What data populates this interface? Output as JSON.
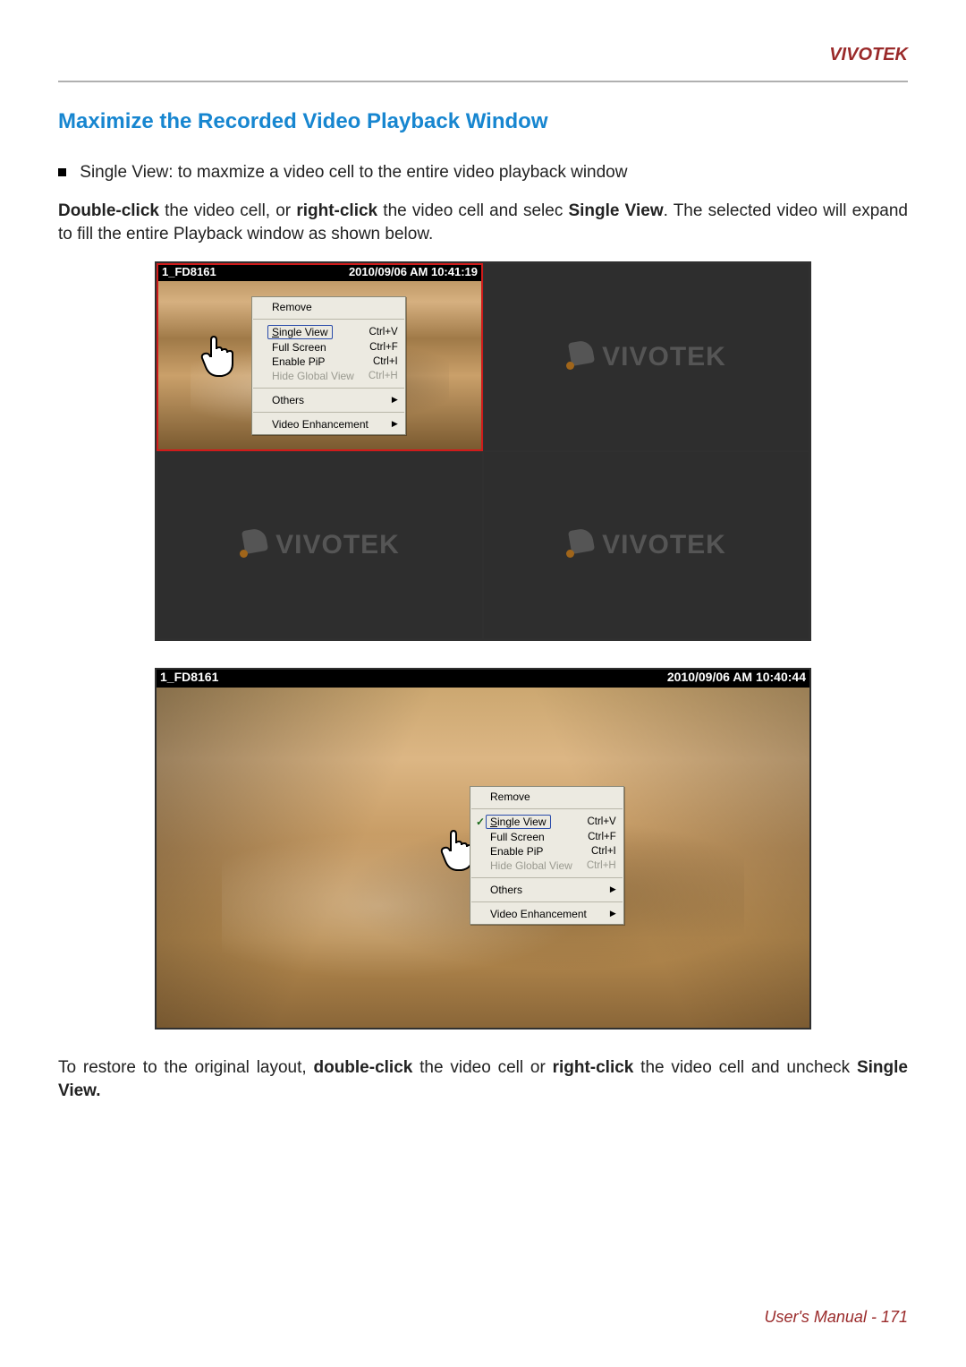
{
  "header": {
    "brand": "VIVOTEK"
  },
  "section": {
    "title": "Maximize the Recorded Video Playback Window",
    "bullet_text": "Single View: to maxmize a video cell to the entire video playback window",
    "para1_a": "Double-click",
    "para1_b": " the video cell, or ",
    "para1_c": "right-click",
    "para1_d": " the video cell and selec ",
    "para1_e": "Single View",
    "para1_f": ". The selected video will expand to fill the entire Playback window as shown below.",
    "para2_a": "To restore to the original layout, ",
    "para2_b": "double-click",
    "para2_c": " the video cell or ",
    "para2_d": "right-click",
    "para2_e": " the video cell and uncheck ",
    "para2_f": "Single View."
  },
  "figure1": {
    "camera_label": "1_FD8161",
    "timestamp": "2010/09/06 AM 10:41:19",
    "menu": {
      "remove": "Remove",
      "single_view": "Single View",
      "single_view_key": "Ctrl+V",
      "full_screen": "Full Screen",
      "full_screen_key": "Ctrl+F",
      "enable_pip": "Enable PiP",
      "enable_pip_key": "Ctrl+I",
      "hide_global": "Hide Global View",
      "hide_global_key": "Ctrl+H",
      "others": "Others",
      "video_enh": "Video Enhancement"
    }
  },
  "figure2": {
    "camera_label": "1_FD8161",
    "timestamp": "2010/09/06 AM 10:40:44",
    "menu": {
      "remove": "Remove",
      "single_view": "Single View",
      "single_view_key": "Ctrl+V",
      "full_screen": "Full Screen",
      "full_screen_key": "Ctrl+F",
      "enable_pip": "Enable PiP",
      "enable_pip_key": "Ctrl+I",
      "hide_global": "Hide Global View",
      "hide_global_key": "Ctrl+H",
      "others": "Others",
      "video_enh": "Video Enhancement"
    }
  },
  "logo_text": "VIVOTEK",
  "footer": {
    "label": "User's Manual - ",
    "page": "171"
  }
}
